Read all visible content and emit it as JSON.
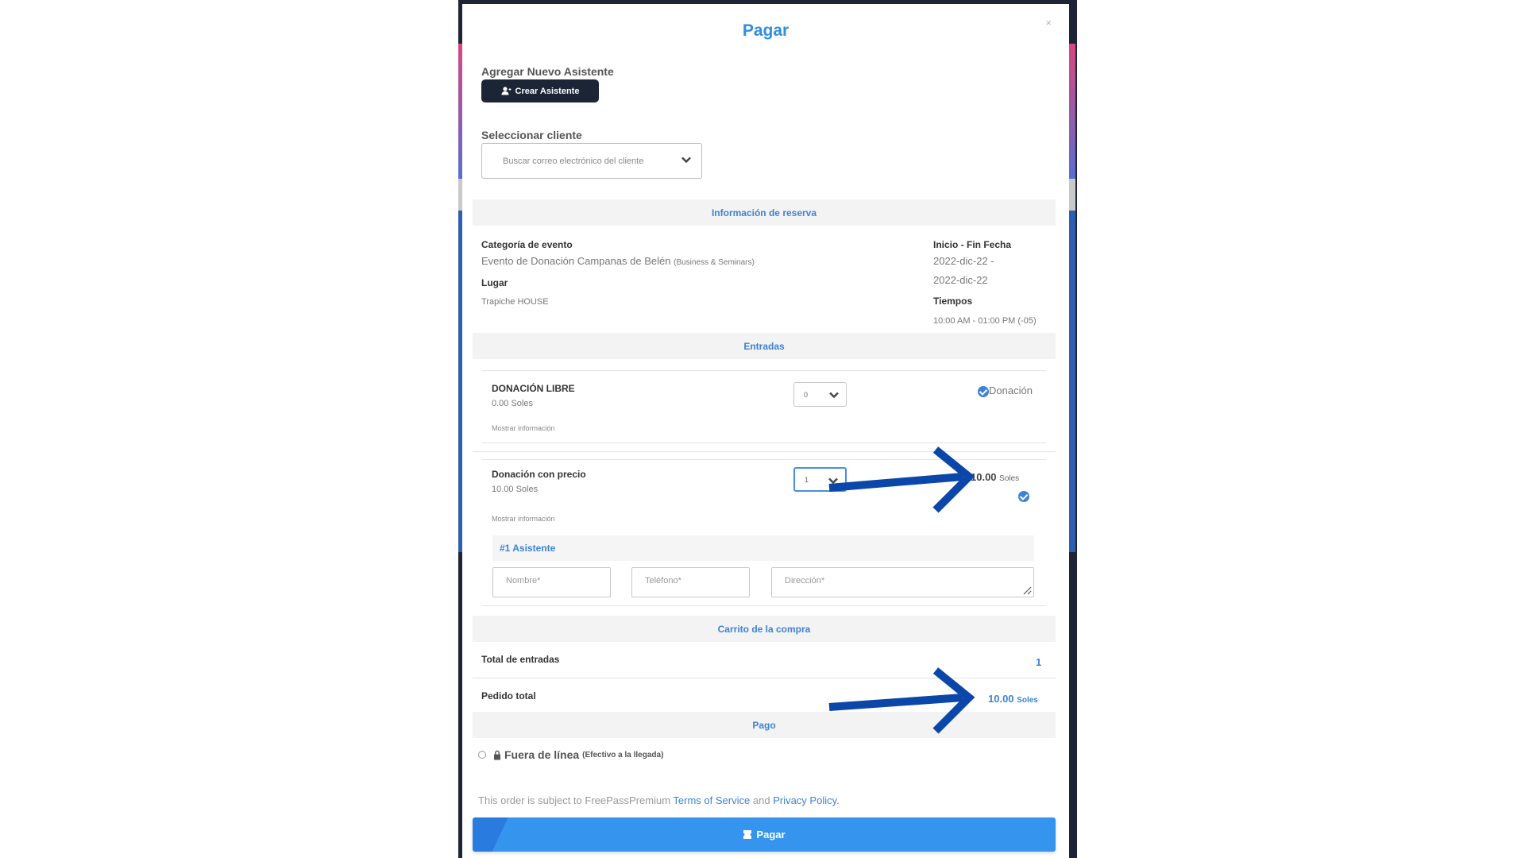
{
  "modal": {
    "title": "Pagar",
    "close_label": "×",
    "add_attendee_label": "Agregar Nuevo Asistente",
    "create_attendee_button": "Crear Asistente",
    "select_client_label": "Seleccionar cliente",
    "client_search_placeholder": "Buscar correo electrónico del cliente"
  },
  "reservation": {
    "section_title": "Información de reserva",
    "event_category_label": "Categoría de evento",
    "event_name": "Evento de Donación Campanas de Belén",
    "event_category": "(Business & Seminars)",
    "venue_label": "Lugar",
    "venue": "Trapiche HOUSE",
    "dates_label": "Inicio - Fin Fecha",
    "start_date": "2022-dic-22 -",
    "end_date": "2022-dic-22",
    "times_label": "Tiempos",
    "times": "10:00 AM - 01:00 PM (-05)"
  },
  "tickets": {
    "section_title": "Entradas",
    "items": [
      {
        "name": "DONACIÓN LIBRE",
        "price": "0.00 Soles",
        "more_info": "Mostrar información",
        "qty": "0",
        "tag": "Donación"
      },
      {
        "name": "Donación con precio",
        "price": "10.00 Soles",
        "more_info": "Mostrar información",
        "qty": "1",
        "subtotal_amount": "10.00",
        "subtotal_currency": "Soles"
      }
    ],
    "attendee_header": "#1 Asistente",
    "name_placeholder": "Nombre*",
    "phone_placeholder": "Teléfono*",
    "address_placeholder": "Dirección*"
  },
  "cart": {
    "section_title": "Carrito de la compra",
    "total_tickets_label": "Total de entradas",
    "total_tickets_value": "1",
    "order_total_label": "Pedido total",
    "order_total_amount": "10.00",
    "order_total_currency": "Soles"
  },
  "payment": {
    "section_title": "Pago",
    "offline_label": "Fuera de línea",
    "offline_note": "(Efectivo a la llegada)",
    "terms_prefix": "This order is subject to FreePassPremium",
    "terms_link": "Terms of Service",
    "terms_and": "and",
    "privacy_link": "Privacy Policy.",
    "pay_button": "Pagar"
  },
  "colors": {
    "accent": "#2f8ee0",
    "annotation_arrow": "#0b47a8",
    "dark_button": "#1c2536"
  }
}
